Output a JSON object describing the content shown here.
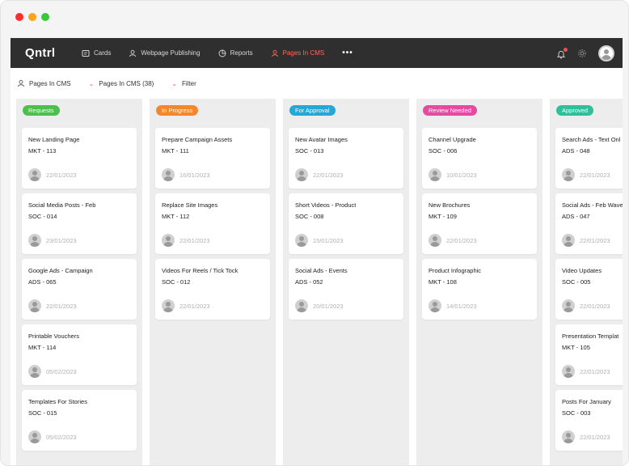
{
  "window": {
    "title_dots": [
      "close",
      "minimize",
      "maximize"
    ]
  },
  "topnav": {
    "logo": "Qntrl",
    "items": [
      {
        "label": "Cards",
        "icon": "cards-icon",
        "active": false
      },
      {
        "label": "Webpage Publishing",
        "icon": "user-group-icon",
        "active": false
      },
      {
        "label": "Reports",
        "icon": "reports-icon",
        "active": false
      },
      {
        "label": "Pages In CMS",
        "icon": "user-group-icon",
        "active": true
      }
    ],
    "more": "•••",
    "accent_color": "#ff6a5c"
  },
  "toolbar": {
    "view_label": "Pages In CMS",
    "filter_view_label": "Pages In CMS (38)",
    "filter_label": "Filter"
  },
  "columns": [
    {
      "status": "Requests",
      "color": "#4cbf4c",
      "cards": [
        {
          "title": "New Landing Page",
          "id": "MKT - 113",
          "date": "22/01/2023"
        },
        {
          "title": "Social Media Posts - Feb",
          "id": "SOC - 014",
          "date": "23/01/2023"
        },
        {
          "title": "Google Ads - Campaign",
          "id": "ADS - 065",
          "date": "22/01/2023"
        },
        {
          "title": "Printable Vouchers",
          "id": "MKT - 114",
          "date": "05/02/2023"
        },
        {
          "title": "Templates For Stories",
          "id": "SOC - 015",
          "date": "05/02/2023"
        }
      ]
    },
    {
      "status": "In Progress",
      "color": "#f5872b",
      "cards": [
        {
          "title": "Prepare Campaign Assets",
          "id": "MKT - 111",
          "date": "16/01/2023"
        },
        {
          "title": "Replace Site Images",
          "id": "MKT - 112",
          "date": "22/01/2023"
        },
        {
          "title": "Videos For Reels / Tick Tock",
          "id": "SOC - 012",
          "date": "22/01/2023"
        }
      ]
    },
    {
      "status": "For Approval",
      "color": "#22a9d8",
      "cards": [
        {
          "title": "New Avatar Images",
          "id": "SOC - 013",
          "date": "22/01/2023"
        },
        {
          "title": "Short Videos - Product",
          "id": "SOC - 008",
          "date": "15/01/2023"
        },
        {
          "title": "Social Ads - Events",
          "id": "ADS - 052",
          "date": "20/01/2023"
        }
      ]
    },
    {
      "status": "Review Needed",
      "color": "#e64aa0",
      "cards": [
        {
          "title": "Channel Upgrade",
          "id": "SOC - 006",
          "date": "10/01/2023"
        },
        {
          "title": "New Brochures",
          "id": "MKT - 109",
          "date": "22/01/2023"
        },
        {
          "title": "Product Infographic",
          "id": "MKT - 108",
          "date": "14/01/2023"
        }
      ]
    },
    {
      "status": "Approved",
      "color": "#2fbf9a",
      "cards": [
        {
          "title": "Search Ads - Text Onl",
          "id": "ADS - 048",
          "date": "22/01/2023"
        },
        {
          "title": "Social Ads - Feb Wave",
          "id": "ADS - 047",
          "date": "22/01/2023"
        },
        {
          "title": "Video Updates",
          "id": "SOC - 005",
          "date": "22/01/2023"
        },
        {
          "title": "Presentation Templat",
          "id": "MKT - 105",
          "date": "22/01/2023"
        },
        {
          "title": "Posts For January",
          "id": "SOC - 003",
          "date": "22/01/2023"
        }
      ]
    }
  ]
}
